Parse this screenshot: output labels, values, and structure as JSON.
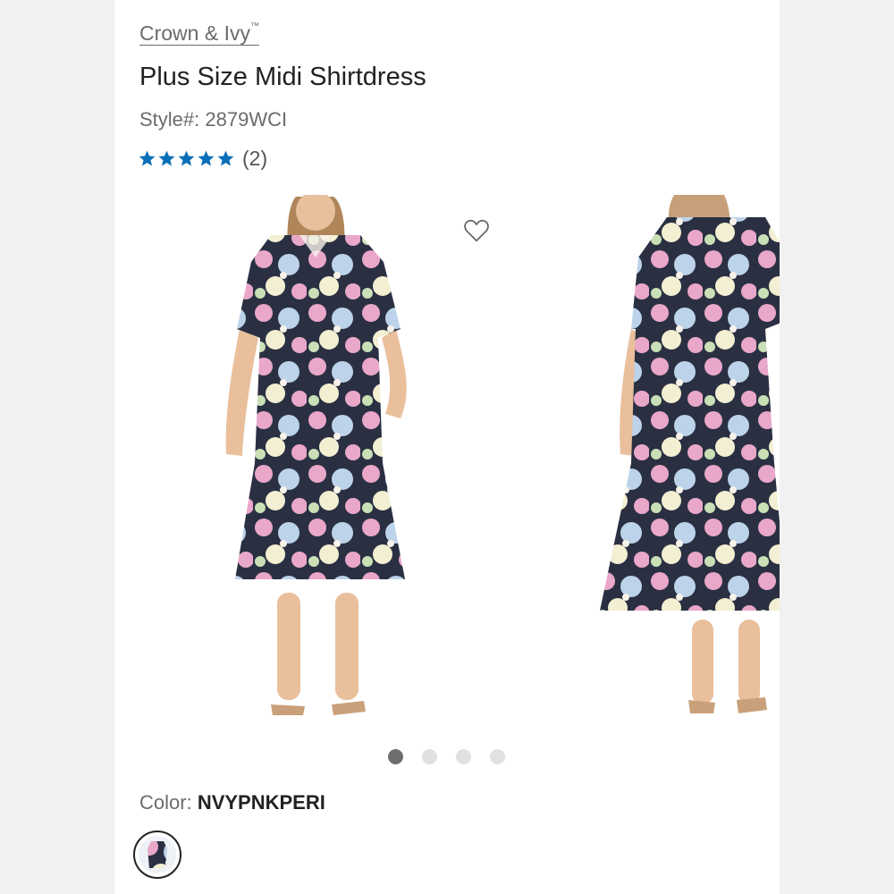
{
  "product": {
    "brand": "Crown & Ivy",
    "brand_tm": "™",
    "title": "Plus Size Midi Shirtdress",
    "style_label": "Style#:",
    "style_number": "2879WCI",
    "rating": 5,
    "review_count": "(2)"
  },
  "gallery": {
    "image_count": 4,
    "active_index": 0
  },
  "color": {
    "label": "Color:",
    "value": "NVYPNKPERI"
  },
  "colors": {
    "star": "#0a6fb8",
    "dot_active": "#6e6e6e",
    "dot_inactive": "#e1e1e1",
    "dress_navy": "#2a3042",
    "dress_pink": "#e9a7c9",
    "dress_blue": "#bcd3ea",
    "dress_cream": "#f3efd2",
    "skin": "#e9bf9c"
  },
  "icons": {
    "favorite": "heart-outline-icon",
    "rating_star": "star-icon"
  }
}
